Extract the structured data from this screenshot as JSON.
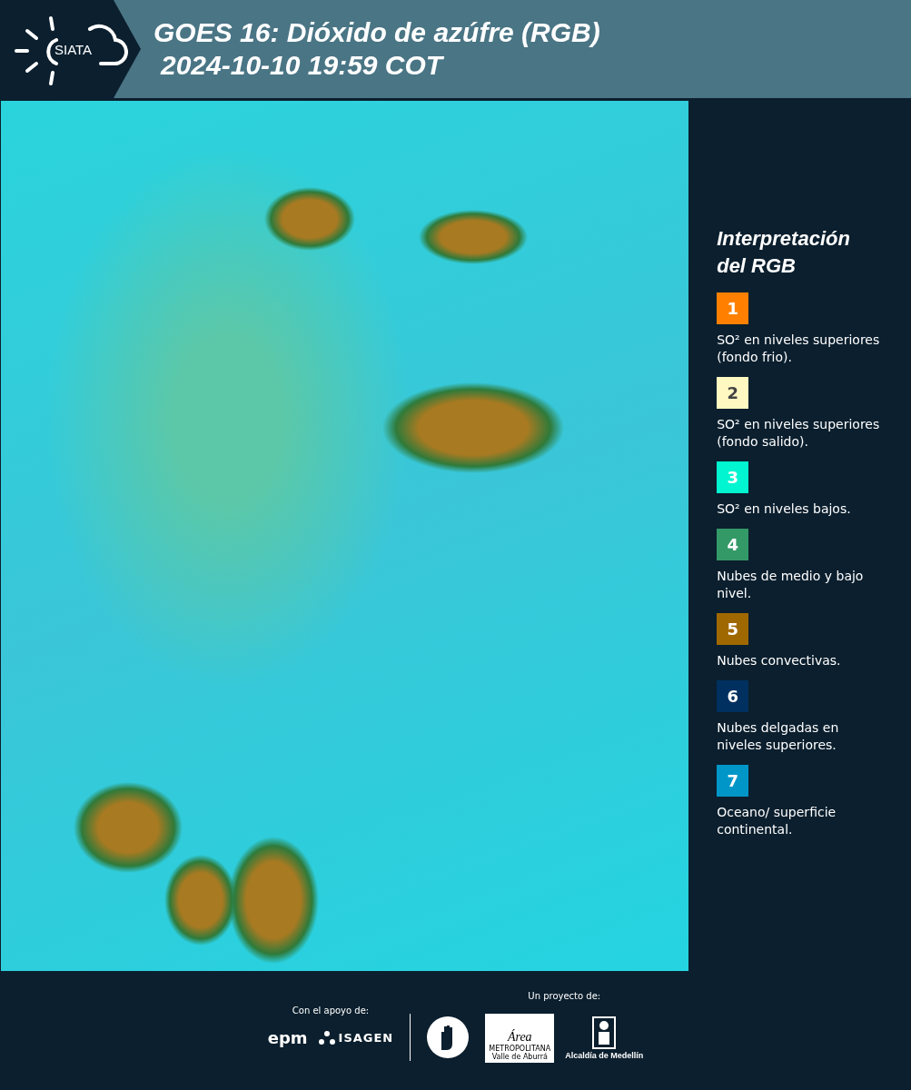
{
  "header": {
    "logo_text": "SIATA",
    "title": "GOES 16: Dióxido de azúfre (RGB)",
    "subtitle": "2024-10-10 19:59 COT"
  },
  "legend": {
    "title": "Interpretación del RGB",
    "items": [
      {
        "number": "1",
        "color": "#ff8000",
        "text": "SO² en niveles superiores (fondo frio)."
      },
      {
        "number": "2",
        "color": "#fff8c0",
        "text": "SO² en niveles superiores (fondo salido)."
      },
      {
        "number": "3",
        "color": "#00f5d0",
        "text": "SO² en niveles bajos."
      },
      {
        "number": "4",
        "color": "#339966",
        "text": "Nubes de medio y bajo nivel."
      },
      {
        "number": "5",
        "color": "#a06800",
        "text": "Nubes convectivas."
      },
      {
        "number": "6",
        "color": "#003060",
        "text": "Nubes delgadas en niveles superiores."
      },
      {
        "number": "7",
        "color": "#0096c8",
        "text": "Oceano/ superficie continental."
      }
    ]
  },
  "footer": {
    "support_label": "Con el apoyo de:",
    "support_logos": [
      "epm",
      "ISAGEN"
    ],
    "project_label": "Un proyecto de:",
    "area_logo": {
      "name": "Área",
      "line1": "METROPOLITANA",
      "line2": "Valle de Aburrá"
    },
    "alcaldia": "Alcaldía de Medellín"
  }
}
